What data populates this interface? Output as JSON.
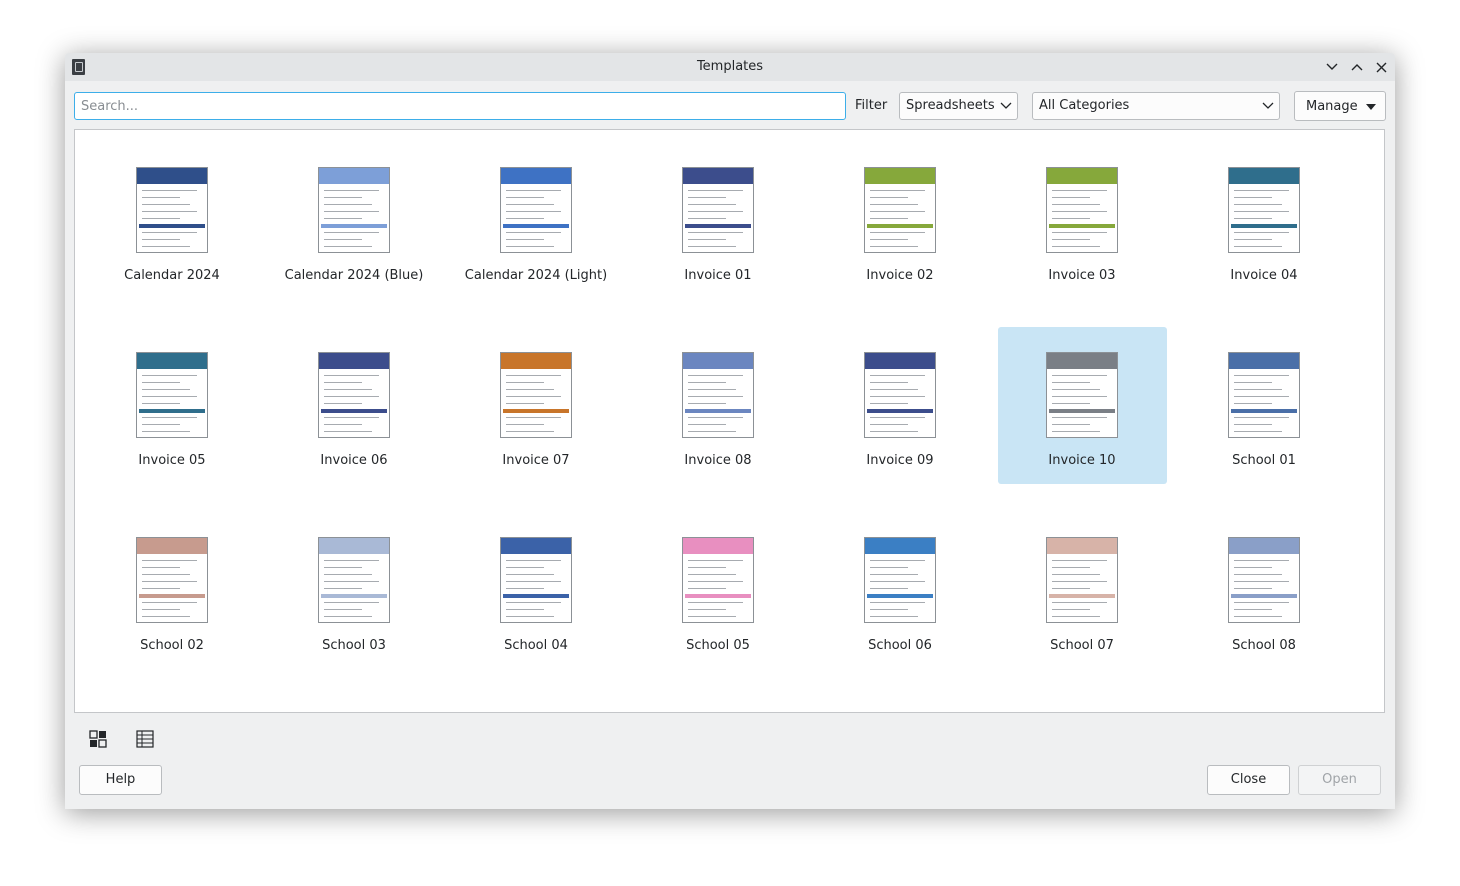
{
  "window": {
    "title": "Templates",
    "icon": "document-icon"
  },
  "toolbar": {
    "search_placeholder": "Search...",
    "filter_label": "Filter",
    "filter_value": "Spreadsheets",
    "category_value": "All Categories",
    "manage_label": "Manage"
  },
  "templates": [
    {
      "label": "Calendar 2024",
      "accent": "#2f4f8a"
    },
    {
      "label": "Calendar 2024 (Blue)",
      "accent": "#7d9fd8"
    },
    {
      "label": "Calendar 2024 (Light)",
      "accent": "#3e72c4"
    },
    {
      "label": "Invoice 01",
      "accent": "#3c4d8c"
    },
    {
      "label": "Invoice 02",
      "accent": "#86a83b"
    },
    {
      "label": "Invoice 03",
      "accent": "#86a83b"
    },
    {
      "label": "Invoice 04",
      "accent": "#2f6e8c"
    },
    {
      "label": "Invoice 05",
      "accent": "#2f6e8c"
    },
    {
      "label": "Invoice 06",
      "accent": "#3c4d8c"
    },
    {
      "label": "Invoice 07",
      "accent": "#c8752a"
    },
    {
      "label": "Invoice 08",
      "accent": "#6b86c0"
    },
    {
      "label": "Invoice 09",
      "accent": "#3c4d8c"
    },
    {
      "label": "Invoice 10",
      "accent": "#7a7f86",
      "selected": true
    },
    {
      "label": "School 01",
      "accent": "#4a6fa8"
    },
    {
      "label": "School 02",
      "accent": "#c79b8e"
    },
    {
      "label": "School 03",
      "accent": "#a9b9d6"
    },
    {
      "label": "School 04",
      "accent": "#3b62a8"
    },
    {
      "label": "School 05",
      "accent": "#e88fc0"
    },
    {
      "label": "School 06",
      "accent": "#3b7fc4"
    },
    {
      "label": "School 07",
      "accent": "#d7b3a8"
    },
    {
      "label": "School 08",
      "accent": "#8a9fc8"
    }
  ],
  "footer": {
    "help_label": "Help",
    "close_label": "Close",
    "open_label": "Open"
  }
}
